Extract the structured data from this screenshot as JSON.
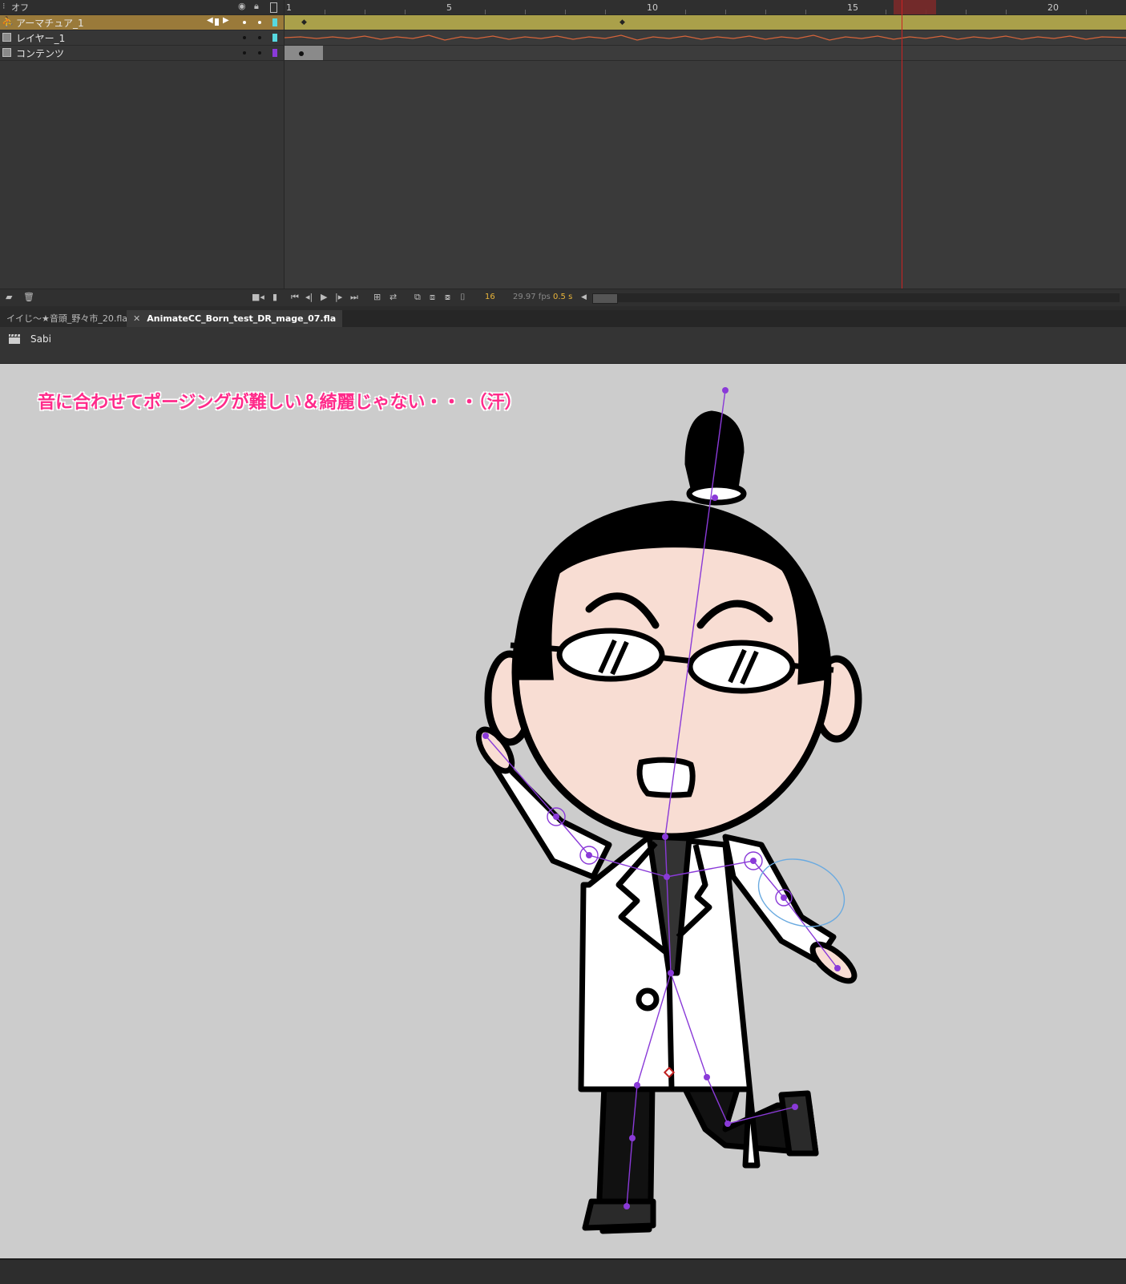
{
  "timeline": {
    "header_label": "オフ",
    "layers": [
      {
        "name": "アーマチュア_1",
        "selected": true,
        "color": "#56d8e0",
        "icon": "armature-icon"
      },
      {
        "name": "レイヤー_1",
        "selected": false,
        "color": "#56d8e0",
        "icon": "layer-icon"
      },
      {
        "name": "コンテンツ",
        "selected": false,
        "color": "#8a3ad8",
        "icon": "layer-icon"
      }
    ],
    "ruler_labels": [
      "1",
      "5",
      "10",
      "15",
      "20"
    ],
    "current_frame": "16",
    "fps": "29.97 fps",
    "elapsed": "0.5 s"
  },
  "tabs": [
    {
      "label": "イイじ〜★音頭_野々市_20.fla*",
      "active": false
    },
    {
      "label": "AnimateCC_Born_test_DR_mage_07.fla",
      "active": true
    }
  ],
  "editbar": {
    "scene_name": "Sabi"
  },
  "stage": {
    "note": "音に合わせてポージングが難しい＆綺麗じゃない・・・（汗）",
    "note_color": "#ff2a8a"
  },
  "colors": {
    "armature_layer_bg": "#9a7a3a",
    "armature_frames": "#aaa04a",
    "playhead": "#cc2222",
    "accent_text": "#e8b43a"
  }
}
